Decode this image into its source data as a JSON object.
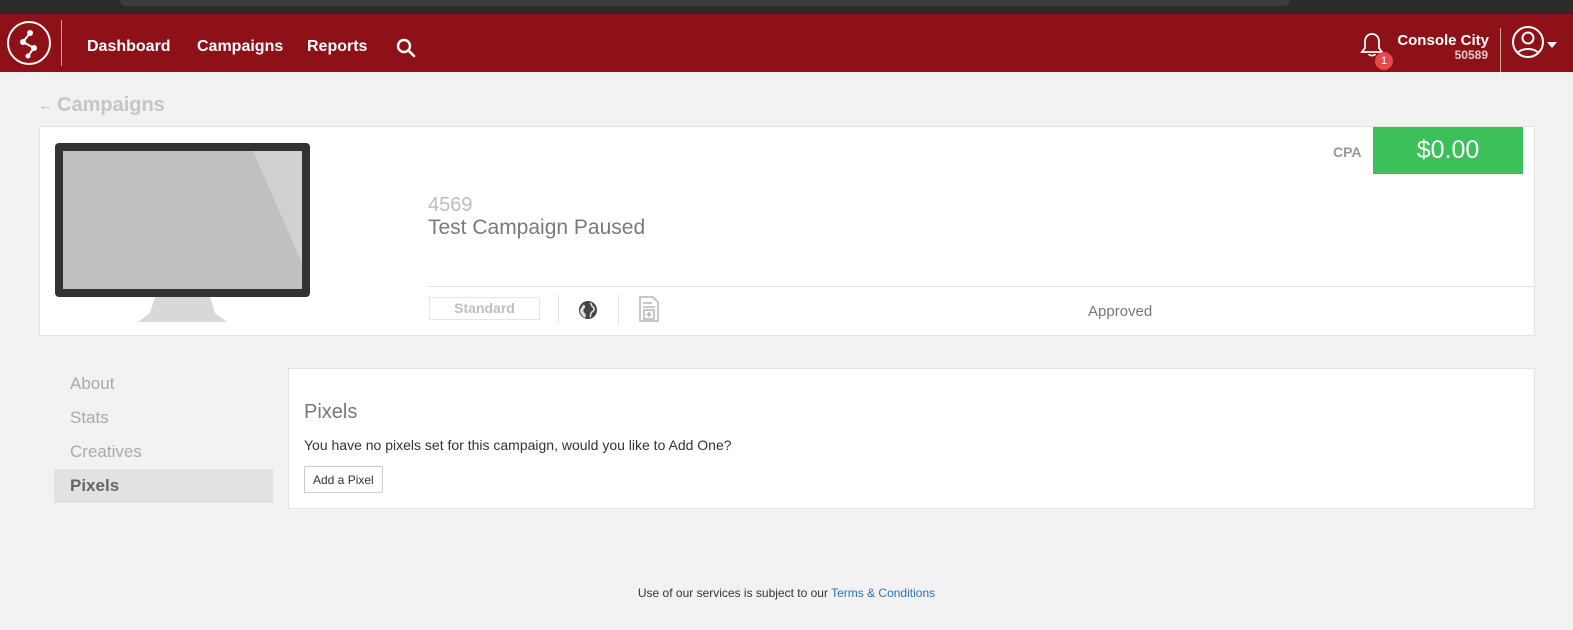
{
  "nav": {
    "links": [
      "Dashboard",
      "Campaigns",
      "Reports"
    ],
    "notification_count": "1",
    "account_name": "Console City",
    "account_id": "50589"
  },
  "breadcrumb": {
    "label": "Campaigns"
  },
  "campaign": {
    "id": "4569",
    "name": "Test Campaign Paused",
    "cpa_label": "CPA",
    "cpa_value": "$0.00",
    "type": "Standard",
    "status": "Approved"
  },
  "sidebar": {
    "items": [
      {
        "label": "About"
      },
      {
        "label": "Stats"
      },
      {
        "label": "Creatives"
      },
      {
        "label": "Pixels"
      }
    ],
    "active": "Pixels"
  },
  "pixels": {
    "title": "Pixels",
    "message": "You have no pixels set for this campaign, would you like to Add One?",
    "add_button": "Add a Pixel"
  },
  "footer": {
    "text": "Use of our services is subject to our ",
    "link": "Terms & Conditions"
  },
  "colors": {
    "navbar": "#8f1118",
    "cpa": "#3bc05a",
    "badge": "#e8474c",
    "link": "#2a72b5"
  }
}
